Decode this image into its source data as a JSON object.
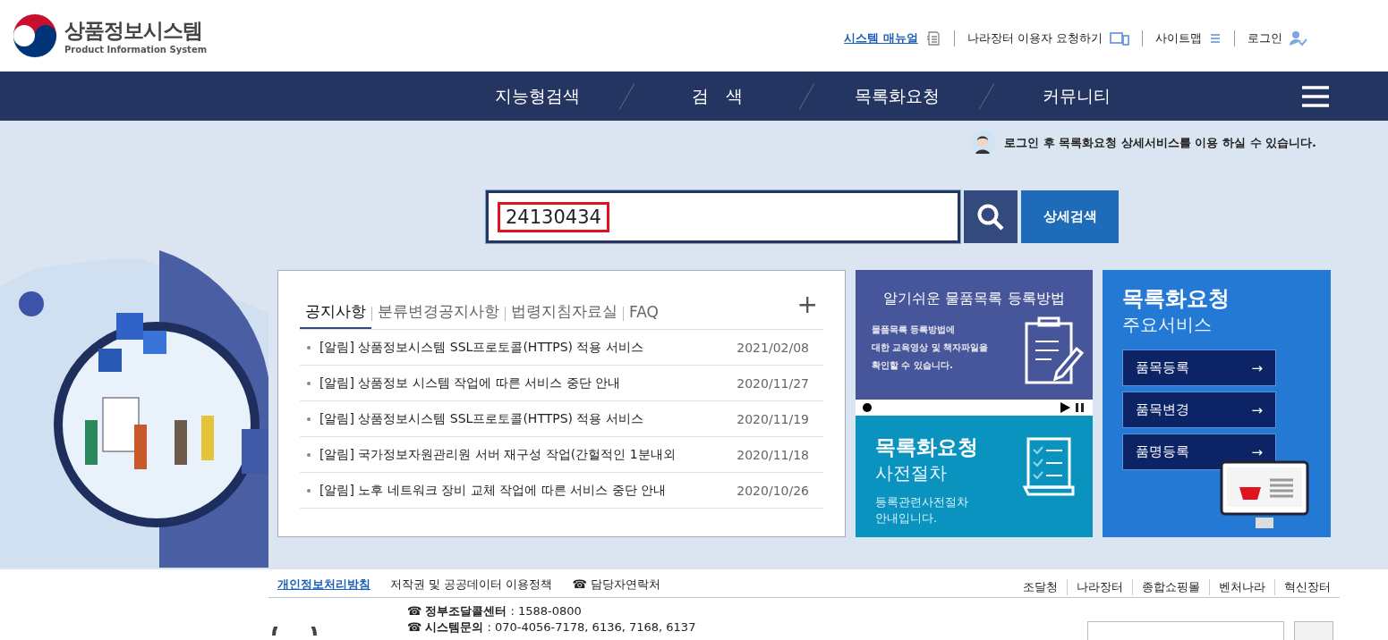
{
  "header": {
    "logo": {
      "title": "상품정보시스템",
      "subtitle": "Product Information System"
    },
    "util_links": [
      {
        "label": "시스템 매뉴얼",
        "kind": "highlight"
      },
      {
        "label": "나라장터 이용자 요청하기",
        "kind": "plain"
      },
      {
        "label": "사이트맵",
        "kind": "plain"
      },
      {
        "label": "로그인",
        "kind": "plain"
      }
    ]
  },
  "nav": {
    "items": [
      "지능형검색",
      "검　색",
      "목록화요청",
      "커뮤니티"
    ]
  },
  "login_notice": "로그인 후 목록화요청 상세서비스를 이용 하실 수 있습니다.",
  "search": {
    "value": "24130434",
    "highlighted": true,
    "detail_button": "상세검색"
  },
  "notices": {
    "tabs": [
      {
        "label": "공지사항",
        "selected": true
      },
      {
        "label": "분류변경공지사항",
        "selected": false
      },
      {
        "label": "법령지침자료실",
        "selected": false
      },
      {
        "label": "FAQ",
        "selected": false
      }
    ],
    "more": "+",
    "items": [
      {
        "title": "[알림] 상품정보시스템 SSL프로토콜(HTTPS) 적용 서비스",
        "date": "2021/02/08"
      },
      {
        "title": "[알림] 상품정보 시스템 작업에 따른 서비스 중단 안내",
        "date": "2020/11/27"
      },
      {
        "title": "[알림] 상품정보시스템 SSL프로토콜(HTTPS) 적용 서비스",
        "date": "2020/11/19"
      },
      {
        "title": "[알림] 국가정보자원관리원 서버 재구성 작업(간헐적인 1분내외",
        "date": "2020/11/18"
      },
      {
        "title": "[알림] 노후 네트워크 장비 교체 작업에 따른 서비스 중단 안내",
        "date": "2020/10/26"
      }
    ]
  },
  "video_panel": {
    "title": "알기쉬운 물품목록 등록방법",
    "description": [
      "물품목록 등록방법에",
      "대한 교육영상 및 책자파일을",
      "확인할 수 있습니다."
    ]
  },
  "preprocedure_panel": {
    "title": "목록화요청",
    "subtitle": "사전절차",
    "description": [
      "등록관련사전절차",
      "안내입니다."
    ]
  },
  "services_panel": {
    "title": "목록화요청",
    "subtitle": "주요서비스",
    "buttons": [
      {
        "label": "품목등록",
        "arrow": "→"
      },
      {
        "label": "품목변경",
        "arrow": "→"
      },
      {
        "label": "품명등록",
        "arrow": "→"
      }
    ]
  },
  "footer": {
    "links": [
      {
        "label": "개인정보처리방침",
        "kind": "highlight"
      },
      {
        "label": "저작권 및 공공데이터 이용정책",
        "kind": "plain"
      },
      {
        "label": "담당자연락처",
        "kind": "phone",
        "icon": "☎"
      }
    ],
    "family_sites": [
      "조달청",
      "나라장터",
      "종합쇼핑몰",
      "벤처나라",
      "혁신장터"
    ],
    "contacts": [
      {
        "icon": "☎",
        "label": "정부조달콜센터",
        "value": " : 1588-0800"
      },
      {
        "icon": "☎",
        "label": "시스템문의",
        "value": " : 070-4056-7178, 6136, 7168, 6137"
      }
    ]
  }
}
